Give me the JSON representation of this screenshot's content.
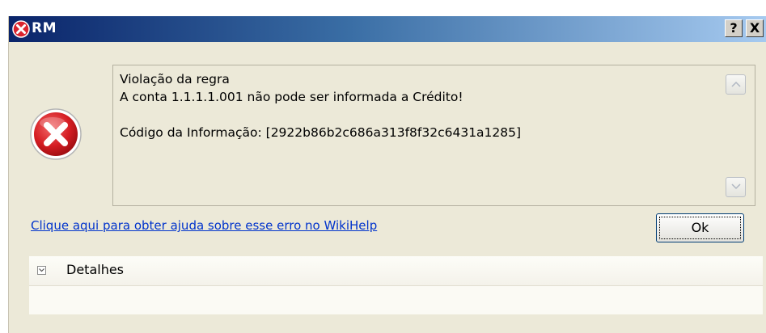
{
  "window": {
    "title": "RM",
    "help_button": "?",
    "close_button": "X"
  },
  "message": {
    "line1": "Violação da regra",
    "line2": "A conta 1.1.1.1.001 não pode ser informada a Crédito!",
    "line3": "Código da Informação: [2922b86b2c686a313f8f32c6431a1285]"
  },
  "help_link": "Clique aqui para obter ajuda sobre esse erro no WikiHelp",
  "ok_button": "Ok",
  "details": {
    "label": "Detalhes",
    "expanded": false
  },
  "icons": {
    "app": "error-icon",
    "message": "error-icon",
    "scroll_up": "chevron-up-icon",
    "scroll_down": "chevron-down-icon",
    "details_toggle": "chevron-down-icon"
  },
  "colors": {
    "link": "#0033cc",
    "error_red": "#d9232e",
    "titlebar_start": "#0a246a",
    "titlebar_end": "#a6caf0"
  }
}
